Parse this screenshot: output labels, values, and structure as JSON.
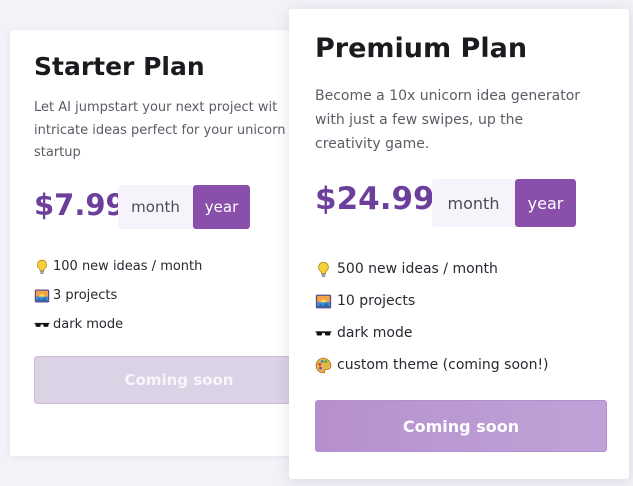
{
  "starter": {
    "title": "Starter Plan",
    "description_lines": [
      "Let AI jumpstart your next project wit",
      "intricate ideas perfect for your unicorn",
      "startup"
    ],
    "price": "$7.99",
    "billing_toggle": {
      "month_label": "month",
      "year_label": "year",
      "selected": "year"
    },
    "features": [
      {
        "icon": "lightbulb-icon",
        "text": "100 new ideas / month"
      },
      {
        "icon": "sunrise-picture-icon",
        "text": "3 projects"
      },
      {
        "icon": "sunglasses-icon",
        "text": "dark mode"
      }
    ],
    "cta_label": "Coming soon"
  },
  "premium": {
    "title": "Premium Plan",
    "description_lines": [
      "Become a 10x unicorn idea generator",
      "with just a few swipes, up the",
      "creativity game."
    ],
    "price": "$24.99",
    "billing_toggle": {
      "month_label": "month",
      "year_label": "year",
      "selected": "year"
    },
    "features": [
      {
        "icon": "lightbulb-icon",
        "text": "500 new ideas / month"
      },
      {
        "icon": "sunrise-picture-icon",
        "text": "10 projects"
      },
      {
        "icon": "sunglasses-icon",
        "text": "dark mode"
      },
      {
        "icon": "palette-icon",
        "text": "custom theme (coming soon!)"
      }
    ],
    "cta_label": "Coming soon"
  },
  "colors": {
    "accent": "#8a4fab",
    "price": "#6b3f9b",
    "cta_disabled": "#dcd2e6",
    "cta_premium": "#b690cc"
  }
}
